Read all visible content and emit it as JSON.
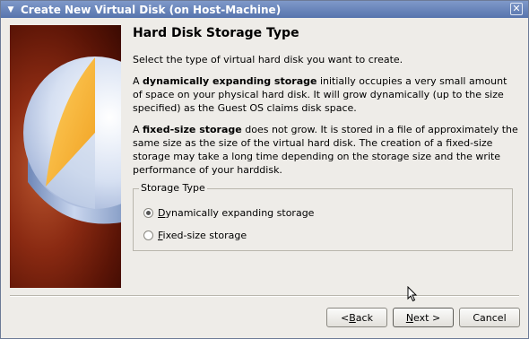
{
  "window": {
    "title": "Create New Virtual Disk (on Host-Machine)",
    "close_glyph": "✕",
    "menu_glyph": "▼"
  },
  "page": {
    "heading": "Hard Disk Storage Type",
    "intro": "Select the type of virtual hard disk you want to create.",
    "dynamic_para": {
      "prefix": "A ",
      "bold": "dynamically expanding storage",
      "rest": " initially occupies a very small amount of space on your physical hard disk. It will grow dynamically (up to the size specified) as the Guest OS claims disk space."
    },
    "fixed_para": {
      "prefix": "A ",
      "bold": "fixed-size storage",
      "rest": " does not grow. It is stored in a file of approximately the same size as the size of the virtual hard disk. The creation of a fixed-size storage may take a long time depending on the storage size and the write performance of your harddisk."
    }
  },
  "storage_type": {
    "legend": "Storage Type",
    "options": [
      {
        "mnemonic": "D",
        "label_rest": "ynamically expanding storage",
        "checked": true
      },
      {
        "mnemonic": "F",
        "label_rest": "ixed-size storage",
        "checked": false
      }
    ]
  },
  "buttons": {
    "back": {
      "prefix": "< ",
      "mnemonic": "B",
      "rest": "ack"
    },
    "next": {
      "mnemonic": "N",
      "rest": "ext >"
    },
    "cancel": "Cancel"
  }
}
